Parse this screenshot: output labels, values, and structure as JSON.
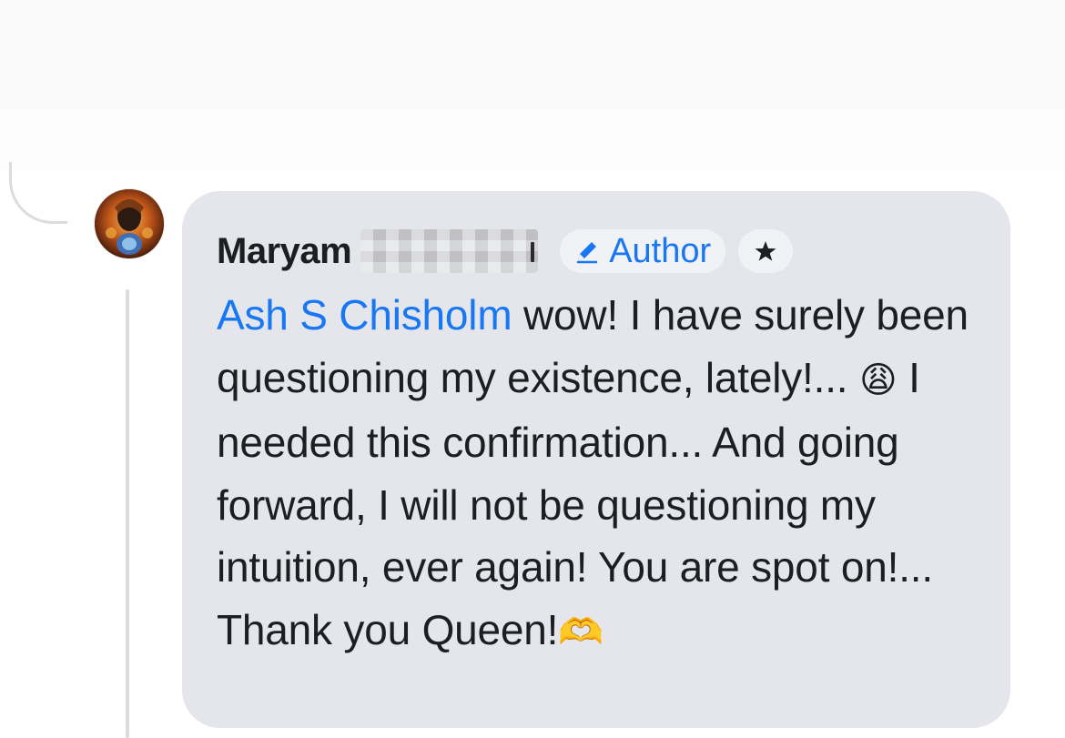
{
  "comment": {
    "author_name": "Maryam",
    "author_badge_label": "Author",
    "author_badge_icon": "pencil-icon",
    "star_badge_icon": "star-icon",
    "mention": "Ash S Chisholm",
    "text_part1": " wow! I have surely been questioning my existence, lately!...",
    "emoji_1": "😩",
    "text_part2": " I needed this confirmation... And going forward, I will not be questioning my intuition, ever again! You are spot on!... Thank you Queen!",
    "emoji_2": "🫶"
  },
  "colors": {
    "bubble_bg": "#e4e6eb",
    "link_blue": "#1877f2",
    "text_dark": "#1c1e21"
  }
}
